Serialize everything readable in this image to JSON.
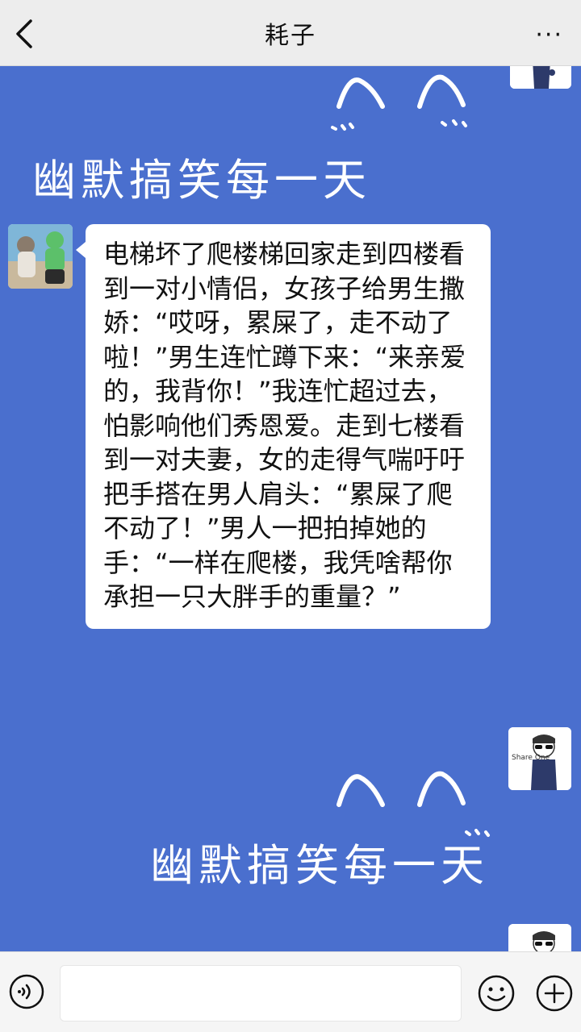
{
  "header": {
    "title": "耗子",
    "more": "···"
  },
  "messages": [
    {
      "side": "left",
      "text": "电梯坏了爬楼梯回家走到四楼看到一对小情侣，女孩子给男生撒娇：“哎呀，累屎了，走不动了啦！”男生连忙蹲下来：“来亲爱的，我背你！”我连忙超过去，怕影响他们秀恩爱。走到七楼看到一对夫妻，女的走得气喘吁吁把手搭在男人肩头：“累屎了爬不动了！”男人一把拍掉她的手：“一样在爬楼，我凭啥帮你承担一只大胖手的重量？”"
    }
  ],
  "stickers": [
    {
      "text": "幽默搞笑每一天"
    },
    {
      "text": "幽默搞笑每一天"
    }
  ],
  "avatar_labels": {
    "self": "Share One"
  },
  "colors": {
    "chat_bg": "#4a6fce",
    "topbar_bg": "#ededed",
    "bubble_bg": "#ffffff"
  },
  "icons": [
    "back-icon",
    "more-icon",
    "voice-icon",
    "emoji-icon",
    "plus-icon"
  ]
}
